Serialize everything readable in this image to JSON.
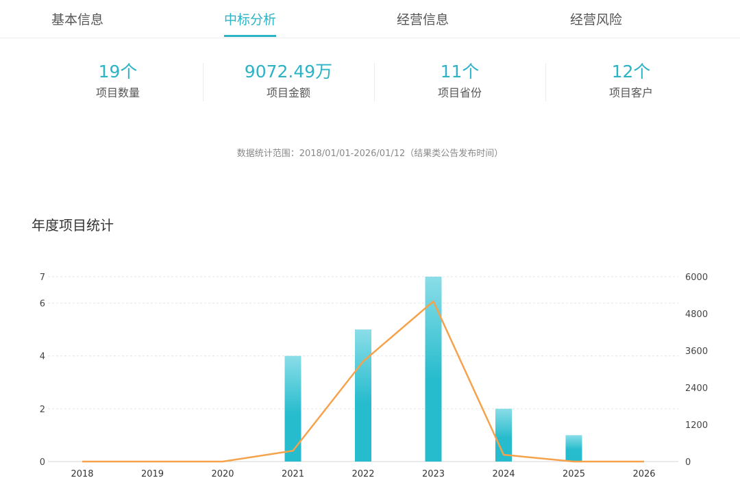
{
  "tabs": [
    {
      "label": "基本信息",
      "active": false
    },
    {
      "label": "中标分析",
      "active": true
    },
    {
      "label": "经营信息",
      "active": false
    },
    {
      "label": "经营风险",
      "active": false
    }
  ],
  "stats": [
    {
      "value": "19个",
      "label": "项目数量"
    },
    {
      "value": "9072.49万",
      "label": "项目金额"
    },
    {
      "value": "11个",
      "label": "项目省份"
    },
    {
      "value": "12个",
      "label": "项目客户"
    }
  ],
  "range_note": "数据统计范围：2018/01/01-2026/01/12（结果类公告发布时间）",
  "section_title": "年度项目统计",
  "colors": {
    "accent": "#2bb3c5",
    "bar_top": "#8adde8",
    "bar_bottom": "#27bccd",
    "line": "#f5a24a"
  },
  "chart_data": {
    "type": "bar",
    "categories": [
      "2018",
      "2019",
      "2020",
      "2021",
      "2022",
      "2023",
      "2024",
      "2025",
      "2026"
    ],
    "series": [
      {
        "type": "bar",
        "axis": "left",
        "values": [
          0,
          0,
          0,
          4,
          5,
          7,
          2,
          1,
          0
        ]
      },
      {
        "type": "line",
        "axis": "right",
        "values": [
          0,
          0,
          0,
          350,
          3250,
          5200,
          220,
          0,
          0
        ]
      }
    ],
    "y_left": {
      "ticks": [
        0,
        2,
        4,
        6,
        7
      ],
      "ylim": [
        0,
        7
      ]
    },
    "y_right": {
      "ticks": [
        0,
        1200,
        2400,
        3600,
        4800,
        6000
      ],
      "ylim": [
        0,
        6000
      ]
    },
    "grid": true,
    "title": "",
    "xlabel": "",
    "ylabel": ""
  }
}
